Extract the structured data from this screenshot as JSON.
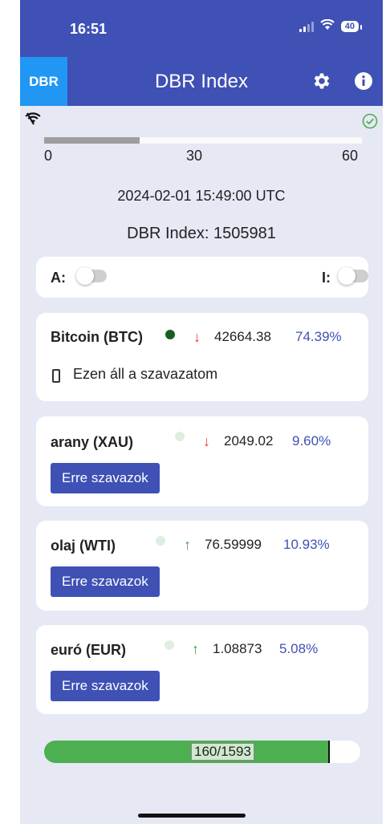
{
  "status_bar": {
    "time": "16:51",
    "battery": "40"
  },
  "app_bar": {
    "logo": "DBR",
    "title": "DBR Index",
    "settings_icon": "gear-icon",
    "info_icon": "info-icon"
  },
  "connection": {
    "wifi_icon": "wifi-icon",
    "ok_icon": "check-circle-icon",
    "ok_color": "#4caf50"
  },
  "timer": {
    "progress_fraction": 0.3,
    "ticks": [
      "0",
      "30",
      "60"
    ]
  },
  "timestamp": "2024-02-01 15:49:00 UTC",
  "index_line": "DBR Index: 1505981",
  "toggles": {
    "a_label": "A:",
    "a_on": false,
    "i_label": "I:",
    "i_on": false
  },
  "assets": [
    {
      "name": "Bitcoin (BTC)",
      "dot_color": "#1b5e20",
      "direction": "down",
      "arrow": "↓",
      "price": "42664.38",
      "percent": "74.39%",
      "voted": true,
      "vote_status": "Ezen áll a szavazatom"
    },
    {
      "name": "arany (XAU)",
      "dot_color": "#dfeee0",
      "direction": "down",
      "arrow": "↓",
      "price": "2049.02",
      "percent": "9.60%",
      "voted": false,
      "button": "Erre szavazok"
    },
    {
      "name": "olaj (WTI)",
      "dot_color": "#dfeee0",
      "direction": "up",
      "arrow": "↑",
      "price": "76.59999",
      "percent": "10.93%",
      "voted": false,
      "button": "Erre szavazok"
    },
    {
      "name": "euró (EUR)",
      "dot_color": "#dfeee0",
      "direction": "up",
      "arrow": "↑",
      "price": "1.08873",
      "percent": "5.08%",
      "voted": false,
      "button": "Erre szavazok"
    }
  ],
  "progress": {
    "label": "160/1593",
    "fill_fraction": 0.9,
    "color": "#4caf50"
  }
}
